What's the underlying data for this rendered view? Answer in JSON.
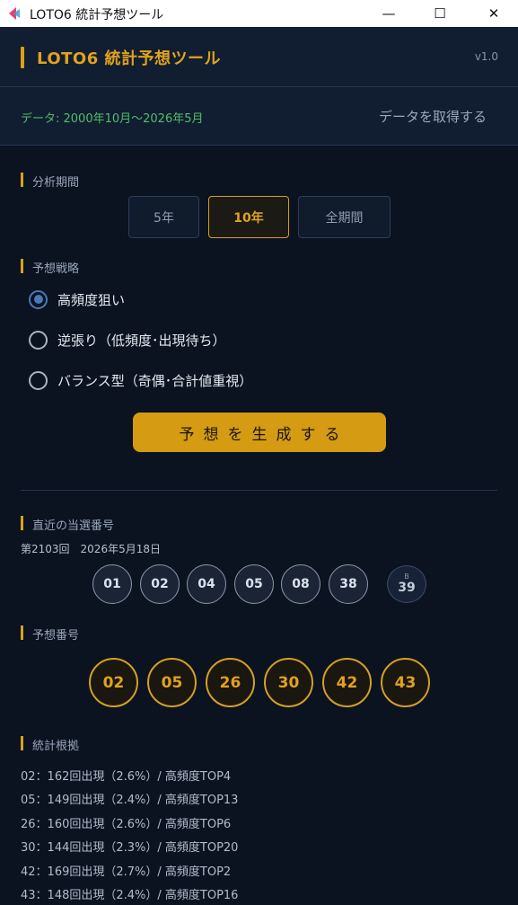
{
  "window": {
    "title": "LOTO6 統計予想ツール",
    "minimize_glyph": "—",
    "maximize_glyph": "☐",
    "close_glyph": "✕"
  },
  "header": {
    "title": "LOTO6 統計予想ツール",
    "version": "v1.0",
    "data_range": "データ: 2000年10月～2026年5月",
    "fetch_label": "データを取得する"
  },
  "period": {
    "label": "分析期間",
    "options": [
      "5年",
      "10年",
      "全期間"
    ],
    "selected": "10年"
  },
  "strategy": {
    "label": "予想戦略",
    "options": [
      "高頻度狙い",
      "逆張り（低頻度･出現待ち）",
      "バランス型（奇偶･合計値重視）"
    ],
    "selected": "高頻度狙い"
  },
  "generate_label": "予想を生成する",
  "recent": {
    "label": "直近の当選番号",
    "draw_info": "第2103回　2026年5月18日",
    "numbers": [
      "01",
      "02",
      "04",
      "05",
      "08",
      "38"
    ],
    "bonus_label": "B",
    "bonus": "39"
  },
  "prediction": {
    "label": "予想番号",
    "numbers": [
      "02",
      "05",
      "26",
      "30",
      "42",
      "43"
    ]
  },
  "stats": {
    "label": "統計根拠",
    "lines": [
      "02：162回出現（2.6%）/ 高頻度TOP4",
      "05：149回出現（2.4%）/ 高頻度TOP13",
      "26：160回出現（2.6%）/ 高頻度TOP6",
      "30：144回出現（2.3%）/ 高頻度TOP20",
      "42：169回出現（2.7%）/ 高頻度TOP2",
      "43：148回出現（2.4%）/ 高頻度TOP16"
    ]
  },
  "colors": {
    "accent": "#d49b13",
    "background": "#0b1220",
    "panel": "#111d30",
    "success_text": "#4fbf6a",
    "radio_selected": "#4a78b8"
  }
}
